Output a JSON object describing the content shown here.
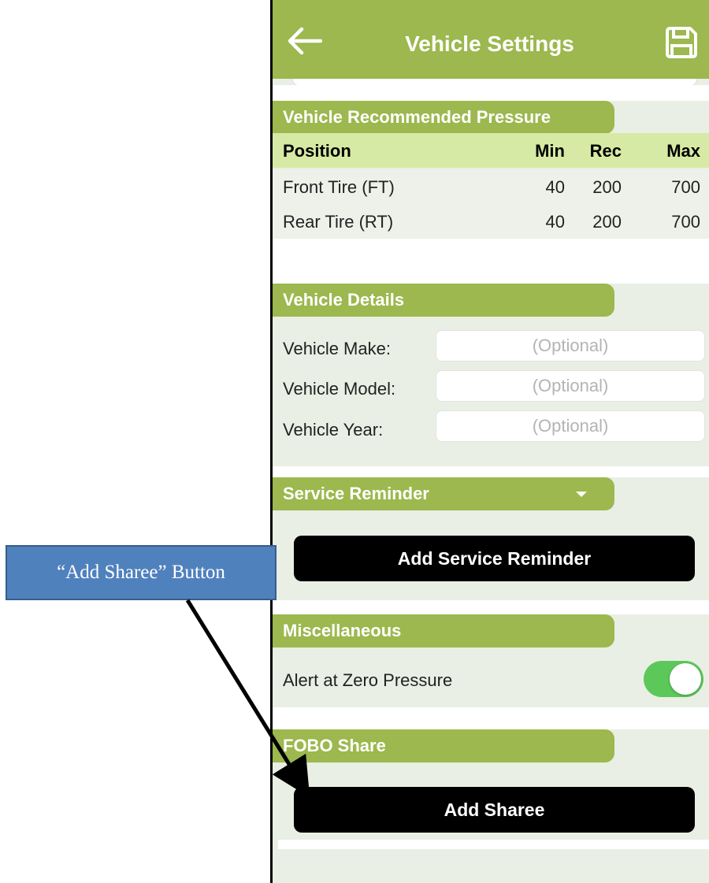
{
  "header": {
    "title": "Vehicle Settings",
    "back_icon": "arrow-left-icon",
    "save_icon": "floppy-disk-icon"
  },
  "pressure": {
    "section_title": "Vehicle Recommended Pressure",
    "columns": [
      "Position",
      "Min",
      "Rec",
      "Max"
    ],
    "rows": [
      {
        "position": "Front Tire (FT)",
        "min": "40",
        "rec": "200",
        "max": "700"
      },
      {
        "position": "Rear Tire (RT)",
        "min": "40",
        "rec": "200",
        "max": "700"
      }
    ]
  },
  "details": {
    "section_title": "Vehicle Details",
    "fields": [
      {
        "label": "Vehicle Make:",
        "placeholder": "(Optional)",
        "value": ""
      },
      {
        "label": "Vehicle Model:",
        "placeholder": "(Optional)",
        "value": ""
      },
      {
        "label": "Vehicle Year:",
        "placeholder": "(Optional)",
        "value": ""
      }
    ]
  },
  "service": {
    "section_title": "Service Reminder",
    "button_label": "Add Service Reminder"
  },
  "misc": {
    "section_title": "Miscellaneous",
    "alert_label": "Alert at Zero Pressure",
    "alert_enabled": true
  },
  "share": {
    "section_title": "FOBO Share",
    "button_label": "Add Sharee"
  },
  "annotation": {
    "callout_text": "“Add Sharee” Button"
  },
  "colors": {
    "accent": "#9cb84e",
    "header_row": "#d7eaa5",
    "toggle_on": "#5cc85a",
    "callout": "#4f81bd"
  }
}
